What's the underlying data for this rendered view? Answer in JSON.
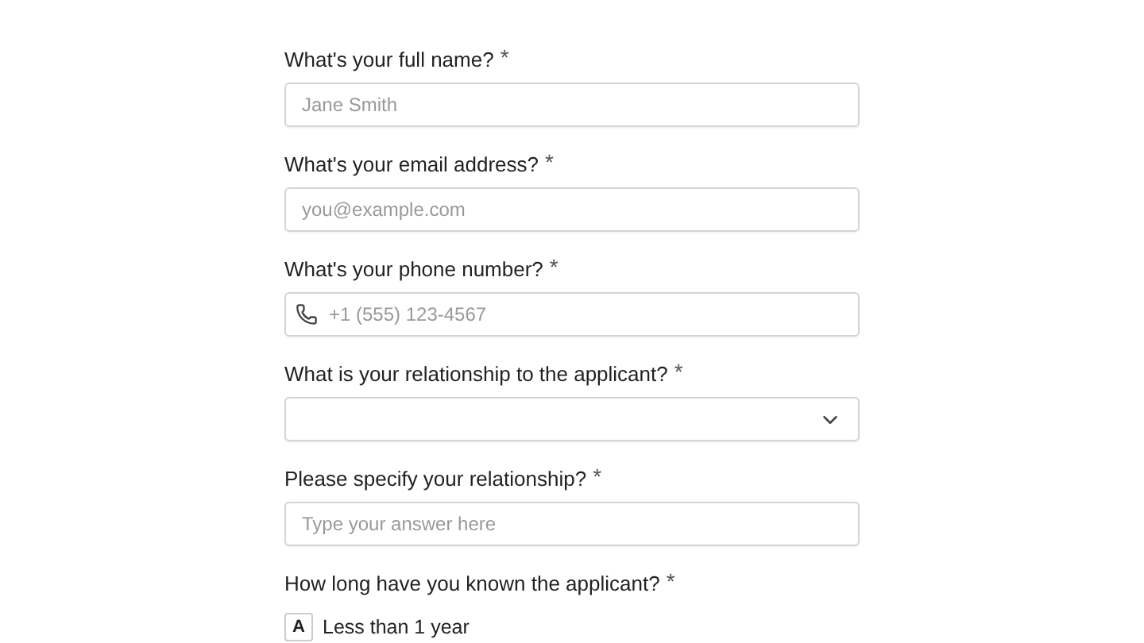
{
  "questions": [
    {
      "kind": "text",
      "label": "What's your full name?",
      "required_mark": "*",
      "placeholder": "Jane Smith"
    },
    {
      "kind": "text",
      "label": "What's your email address?",
      "required_mark": "*",
      "placeholder": "you@example.com"
    },
    {
      "kind": "phone",
      "label": "What's your phone number?",
      "required_mark": "*",
      "placeholder": "+1 (555) 123-4567"
    },
    {
      "kind": "select",
      "label": "What is your relationship to the applicant?",
      "required_mark": "*"
    },
    {
      "kind": "text",
      "label": "Please specify your relationship?",
      "required_mark": "*",
      "placeholder": "Type your answer here"
    },
    {
      "kind": "choice",
      "label": "How long have you known the applicant?",
      "required_mark": "*",
      "options": [
        {
          "key": "A",
          "label": "Less than 1 year",
          "selected": false
        }
      ]
    }
  ]
}
